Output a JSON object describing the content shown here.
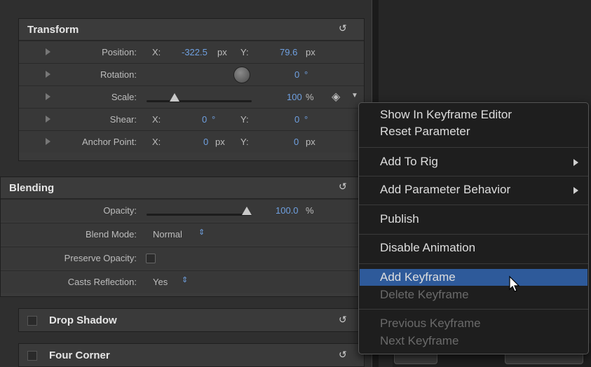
{
  "transform": {
    "title": "Transform",
    "position_label": "Position:",
    "x_label": "X:",
    "position_x": "-322.5",
    "y_label": "Y:",
    "position_y": "79.6",
    "px": "px",
    "rotation_label": "Rotation:",
    "rotation_value": "0",
    "degree": "°",
    "scale_label": "Scale:",
    "scale_value": "100",
    "percent": "%",
    "shear_label": "Shear:",
    "shear_x": "0",
    "shear_y": "0",
    "anchor_label": "Anchor Point:",
    "anchor_x": "0",
    "anchor_y": "0"
  },
  "blending": {
    "title": "Blending",
    "opacity_label": "Opacity:",
    "opacity_value": "100.0",
    "percent": "%",
    "blend_mode_label": "Blend Mode:",
    "blend_mode_value": "Normal",
    "preserve_opacity_label": "Preserve Opacity:",
    "casts_reflection_label": "Casts Reflection:",
    "casts_reflection_value": "Yes"
  },
  "drop_shadow": {
    "title": "Drop Shadow"
  },
  "four_corner": {
    "title": "Four Corner"
  },
  "context_menu": {
    "items": [
      "Show In Keyframe Editor",
      "Reset Parameter",
      "Add To Rig",
      "Add Parameter Behavior",
      "Publish",
      "Disable Animation",
      "Add Keyframe",
      "Delete Keyframe",
      "Previous Keyframe",
      "Next Keyframe"
    ]
  },
  "colors": {
    "value_blue": "#6fa0e0",
    "menu_highlight": "#2e5a9a"
  }
}
